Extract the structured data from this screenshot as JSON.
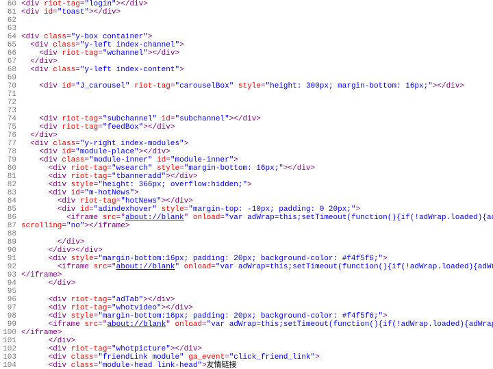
{
  "lines": [
    {
      "n": 60,
      "seg": [
        {
          "c": "p",
          "t": "<div"
        },
        {
          "c": "r",
          "t": " riot-tag"
        },
        {
          "c": "p",
          "t": "="
        },
        {
          "c": "b",
          "t": "\"login\""
        },
        {
          "c": "p",
          "t": "></div>"
        }
      ]
    },
    {
      "n": 61,
      "seg": [
        {
          "c": "p",
          "t": "<div"
        },
        {
          "c": "r",
          "t": " id"
        },
        {
          "c": "p",
          "t": "="
        },
        {
          "c": "b",
          "t": "\"toast\""
        },
        {
          "c": "p",
          "t": "></div>"
        }
      ]
    },
    {
      "n": 62,
      "seg": []
    },
    {
      "n": 63,
      "seg": []
    },
    {
      "n": 64,
      "seg": [
        {
          "c": "p",
          "t": "<div"
        },
        {
          "c": "r",
          "t": " class"
        },
        {
          "c": "p",
          "t": "="
        },
        {
          "c": "b",
          "t": "\"y-box container\""
        },
        {
          "c": "p",
          "t": ">"
        }
      ]
    },
    {
      "n": 65,
      "seg": [
        {
          "c": "",
          "t": "  "
        },
        {
          "c": "p",
          "t": "<div"
        },
        {
          "c": "r",
          "t": " class"
        },
        {
          "c": "p",
          "t": "="
        },
        {
          "c": "b",
          "t": "\"y-left index-channel\""
        },
        {
          "c": "p",
          "t": ">"
        }
      ]
    },
    {
      "n": 66,
      "seg": [
        {
          "c": "",
          "t": "    "
        },
        {
          "c": "p",
          "t": "<div"
        },
        {
          "c": "r",
          "t": " riot-tag"
        },
        {
          "c": "p",
          "t": "="
        },
        {
          "c": "b",
          "t": "\"wchannel\""
        },
        {
          "c": "p",
          "t": "></div>"
        }
      ]
    },
    {
      "n": 67,
      "seg": [
        {
          "c": "",
          "t": "  "
        },
        {
          "c": "p",
          "t": "</div>"
        }
      ]
    },
    {
      "n": 68,
      "seg": [
        {
          "c": "",
          "t": "  "
        },
        {
          "c": "p",
          "t": "<div"
        },
        {
          "c": "r",
          "t": " class"
        },
        {
          "c": "p",
          "t": "="
        },
        {
          "c": "b",
          "t": "\"y-left index-content\""
        },
        {
          "c": "p",
          "t": ">"
        }
      ]
    },
    {
      "n": 69,
      "seg": []
    },
    {
      "n": 70,
      "seg": [
        {
          "c": "",
          "t": "    "
        },
        {
          "c": "p",
          "t": "<div"
        },
        {
          "c": "r",
          "t": " id"
        },
        {
          "c": "p",
          "t": "="
        },
        {
          "c": "b",
          "t": "\"J_carousel\""
        },
        {
          "c": "r",
          "t": " riot-tag"
        },
        {
          "c": "p",
          "t": "="
        },
        {
          "c": "b",
          "t": "\"carouselBox\""
        },
        {
          "c": "r",
          "t": " style"
        },
        {
          "c": "p",
          "t": "="
        },
        {
          "c": "b",
          "t": "\"height: 300px; margin-bottom: 16px;\""
        },
        {
          "c": "p",
          "t": "></div>"
        }
      ]
    },
    {
      "n": 71,
      "seg": []
    },
    {
      "n": 72,
      "seg": []
    },
    {
      "n": 73,
      "seg": []
    },
    {
      "n": 74,
      "seg": [
        {
          "c": "",
          "t": "    "
        },
        {
          "c": "p",
          "t": "<div"
        },
        {
          "c": "r",
          "t": " riot-tag"
        },
        {
          "c": "p",
          "t": "="
        },
        {
          "c": "b",
          "t": "\"subchannel\""
        },
        {
          "c": "r",
          "t": " id"
        },
        {
          "c": "p",
          "t": "="
        },
        {
          "c": "b",
          "t": "\"subchannel\""
        },
        {
          "c": "p",
          "t": "></div>"
        }
      ]
    },
    {
      "n": 75,
      "seg": [
        {
          "c": "",
          "t": "    "
        },
        {
          "c": "p",
          "t": "<div"
        },
        {
          "c": "r",
          "t": " riot-tag"
        },
        {
          "c": "p",
          "t": "="
        },
        {
          "c": "b",
          "t": "\"feedBox\""
        },
        {
          "c": "p",
          "t": "></div>"
        }
      ]
    },
    {
      "n": 76,
      "seg": [
        {
          "c": "",
          "t": "  "
        },
        {
          "c": "p",
          "t": "</div>"
        }
      ]
    },
    {
      "n": 77,
      "seg": [
        {
          "c": "",
          "t": "  "
        },
        {
          "c": "p",
          "t": "<div"
        },
        {
          "c": "r",
          "t": " class"
        },
        {
          "c": "p",
          "t": "="
        },
        {
          "c": "b",
          "t": "\"y-right index-modules\""
        },
        {
          "c": "p",
          "t": ">"
        }
      ]
    },
    {
      "n": 78,
      "seg": [
        {
          "c": "",
          "t": "    "
        },
        {
          "c": "p",
          "t": "<div"
        },
        {
          "c": "r",
          "t": " id"
        },
        {
          "c": "p",
          "t": "="
        },
        {
          "c": "b",
          "t": "\"module-place\""
        },
        {
          "c": "p",
          "t": "></div>"
        }
      ]
    },
    {
      "n": 79,
      "seg": [
        {
          "c": "",
          "t": "    "
        },
        {
          "c": "p",
          "t": "<div"
        },
        {
          "c": "r",
          "t": " class"
        },
        {
          "c": "p",
          "t": "="
        },
        {
          "c": "b",
          "t": "\"module-inner\""
        },
        {
          "c": "r",
          "t": " id"
        },
        {
          "c": "p",
          "t": "="
        },
        {
          "c": "b",
          "t": "\"module-inner\""
        },
        {
          "c": "p",
          "t": ">"
        }
      ]
    },
    {
      "n": 80,
      "seg": [
        {
          "c": "",
          "t": "      "
        },
        {
          "c": "p",
          "t": "<div"
        },
        {
          "c": "r",
          "t": " riot-tag"
        },
        {
          "c": "p",
          "t": "="
        },
        {
          "c": "b",
          "t": "\"wsearch\""
        },
        {
          "c": "r",
          "t": " style"
        },
        {
          "c": "p",
          "t": "="
        },
        {
          "c": "b",
          "t": "\"margin-bottom: 16px;\""
        },
        {
          "c": "p",
          "t": "></div>"
        }
      ]
    },
    {
      "n": 81,
      "seg": [
        {
          "c": "",
          "t": "      "
        },
        {
          "c": "p",
          "t": "<div"
        },
        {
          "c": "r",
          "t": " riot-tag"
        },
        {
          "c": "p",
          "t": "="
        },
        {
          "c": "b",
          "t": "\"tbanneradd\""
        },
        {
          "c": "p",
          "t": "></div>"
        }
      ]
    },
    {
      "n": 82,
      "seg": [
        {
          "c": "",
          "t": "      "
        },
        {
          "c": "p",
          "t": "<div"
        },
        {
          "c": "r",
          "t": " style"
        },
        {
          "c": "p",
          "t": "="
        },
        {
          "c": "b",
          "t": "\"height: 366px; overflow:hidden;\""
        },
        {
          "c": "p",
          "t": ">"
        }
      ]
    },
    {
      "n": 83,
      "seg": [
        {
          "c": "",
          "t": "      "
        },
        {
          "c": "p",
          "t": "<div"
        },
        {
          "c": "r",
          "t": " id"
        },
        {
          "c": "p",
          "t": "="
        },
        {
          "c": "b",
          "t": "\"m-hotNews\""
        },
        {
          "c": "p",
          "t": ">"
        }
      ]
    },
    {
      "n": 84,
      "seg": [
        {
          "c": "",
          "t": "        "
        },
        {
          "c": "p",
          "t": "<div"
        },
        {
          "c": "r",
          "t": " riot-tag"
        },
        {
          "c": "p",
          "t": "="
        },
        {
          "c": "b",
          "t": "\"hotNews\""
        },
        {
          "c": "p",
          "t": "></div>"
        }
      ]
    },
    {
      "n": 85,
      "seg": [
        {
          "c": "",
          "t": "        "
        },
        {
          "c": "p",
          "t": "<div"
        },
        {
          "c": "r",
          "t": " id"
        },
        {
          "c": "p",
          "t": "="
        },
        {
          "c": "b",
          "t": "\"adindexhover\""
        },
        {
          "c": "r",
          "t": " style"
        },
        {
          "c": "p",
          "t": "="
        },
        {
          "c": "b",
          "t": "\"margin-top: -10px; padding: 0 20px;\""
        },
        {
          "c": "p",
          "t": ">"
        }
      ]
    },
    {
      "n": 86,
      "seg": [
        {
          "c": "",
          "t": "          "
        },
        {
          "c": "p",
          "t": "<iframe"
        },
        {
          "c": "r",
          "t": " src"
        },
        {
          "c": "p",
          "t": "=\""
        },
        {
          "c": "lnk",
          "t": "about://blank"
        },
        {
          "c": "p",
          "t": "\""
        },
        {
          "c": "r",
          "t": " onload"
        },
        {
          "c": "p",
          "t": "="
        },
        {
          "c": "b",
          "t": "\"var adWrap=this;setTimeout(function(){if(!adWrap.loaded){adWrap.src='//www.toutiao.com/api/pc/adsafe/'+'#group=in"
        }
      ]
    },
    {
      "n": 87,
      "seg": [
        {
          "c": "r",
          "t": "scrolling"
        },
        {
          "c": "p",
          "t": "="
        },
        {
          "c": "b",
          "t": "\"no\""
        },
        {
          "c": "p",
          "t": "></iframe>"
        }
      ]
    },
    {
      "n": 88,
      "seg": []
    },
    {
      "n": 89,
      "seg": [
        {
          "c": "",
          "t": "        "
        },
        {
          "c": "p",
          "t": "</div>"
        }
      ]
    },
    {
      "n": 90,
      "seg": [
        {
          "c": "",
          "t": "      "
        },
        {
          "c": "p",
          "t": "</div></div>"
        }
      ]
    },
    {
      "n": 91,
      "seg": [
        {
          "c": "",
          "t": "      "
        },
        {
          "c": "p",
          "t": "<div"
        },
        {
          "c": "r",
          "t": " style"
        },
        {
          "c": "p",
          "t": "="
        },
        {
          "c": "b",
          "t": "\"margin-bottom:16px; padding: 20px; background-color: #f4f5f6;\""
        },
        {
          "c": "p",
          "t": ">"
        }
      ]
    },
    {
      "n": 92,
      "seg": [
        {
          "c": "",
          "t": "        "
        },
        {
          "c": "p",
          "t": "<iframe"
        },
        {
          "c": "r",
          "t": " src"
        },
        {
          "c": "p",
          "t": "=\""
        },
        {
          "c": "lnk",
          "t": "about://blank"
        },
        {
          "c": "p",
          "t": "\""
        },
        {
          "c": "r",
          "t": " onload"
        },
        {
          "c": "p",
          "t": "="
        },
        {
          "c": "b",
          "t": "\"var adWrap=this;setTimeout(function(){if(!adWrap.loaded){adWrap.src='//www.toutiao.com/api/pc/adsafe/'+'#group=in"
        }
      ]
    },
    {
      "n": 93,
      "seg": [
        {
          "c": "p",
          "t": "</iframe>"
        }
      ]
    },
    {
      "n": 94,
      "seg": [
        {
          "c": "",
          "t": "      "
        },
        {
          "c": "p",
          "t": "</div>"
        }
      ]
    },
    {
      "n": 95,
      "seg": []
    },
    {
      "n": 96,
      "seg": [
        {
          "c": "",
          "t": "      "
        },
        {
          "c": "p",
          "t": "<div"
        },
        {
          "c": "r",
          "t": " riot-tag"
        },
        {
          "c": "p",
          "t": "="
        },
        {
          "c": "b",
          "t": "\"adTab\""
        },
        {
          "c": "p",
          "t": "></div>"
        }
      ]
    },
    {
      "n": 97,
      "seg": [
        {
          "c": "",
          "t": "      "
        },
        {
          "c": "p",
          "t": "<div"
        },
        {
          "c": "r",
          "t": " riot-tag"
        },
        {
          "c": "p",
          "t": "="
        },
        {
          "c": "b",
          "t": "\"whotvideo\""
        },
        {
          "c": "p",
          "t": "></div>"
        }
      ]
    },
    {
      "n": 98,
      "seg": [
        {
          "c": "",
          "t": "      "
        },
        {
          "c": "p",
          "t": "<div"
        },
        {
          "c": "r",
          "t": " style"
        },
        {
          "c": "p",
          "t": "="
        },
        {
          "c": "b",
          "t": "\"margin-bottom:16px; padding: 20px; background-color: #f4f5f6;\""
        },
        {
          "c": "p",
          "t": ">"
        }
      ]
    },
    {
      "n": 99,
      "seg": [
        {
          "c": "",
          "t": "      "
        },
        {
          "c": "p",
          "t": "<iframe"
        },
        {
          "c": "r",
          "t": " src"
        },
        {
          "c": "p",
          "t": "=\""
        },
        {
          "c": "lnk",
          "t": "about://blank"
        },
        {
          "c": "p",
          "t": "\""
        },
        {
          "c": "r",
          "t": " onload"
        },
        {
          "c": "p",
          "t": "="
        },
        {
          "c": "b",
          "t": "\"var adWrap=this;setTimeout(function(){if(!adWrap.loaded){adWrap.src='//www.toutiao.com/api/pc/adsafe/'+'#group=index_"
        }
      ]
    },
    {
      "n": 100,
      "seg": [
        {
          "c": "p",
          "t": "</iframe>"
        }
      ]
    },
    {
      "n": 101,
      "seg": [
        {
          "c": "",
          "t": "      "
        },
        {
          "c": "p",
          "t": "</div>"
        }
      ]
    },
    {
      "n": 102,
      "seg": [
        {
          "c": "",
          "t": "      "
        },
        {
          "c": "p",
          "t": "<div"
        },
        {
          "c": "r",
          "t": " riot-tag"
        },
        {
          "c": "p",
          "t": "="
        },
        {
          "c": "b",
          "t": "\"whotpicture\""
        },
        {
          "c": "p",
          "t": "></div>"
        }
      ]
    },
    {
      "n": 103,
      "seg": [
        {
          "c": "",
          "t": "      "
        },
        {
          "c": "p",
          "t": "<div"
        },
        {
          "c": "r",
          "t": " class"
        },
        {
          "c": "p",
          "t": "="
        },
        {
          "c": "b",
          "t": "\"friendLink module\""
        },
        {
          "c": "r",
          "t": " ga_event"
        },
        {
          "c": "p",
          "t": "="
        },
        {
          "c": "b",
          "t": "\"click_friend_link\""
        },
        {
          "c": "p",
          "t": ">"
        }
      ]
    },
    {
      "n": 104,
      "seg": [
        {
          "c": "",
          "t": "      "
        },
        {
          "c": "p",
          "t": "<div"
        },
        {
          "c": "r",
          "t": " class"
        },
        {
          "c": "p",
          "t": "="
        },
        {
          "c": "b",
          "t": "\"module-head link-head\""
        },
        {
          "c": "p",
          "t": ">"
        },
        {
          "c": "",
          "t": "友情链接"
        }
      ]
    }
  ]
}
